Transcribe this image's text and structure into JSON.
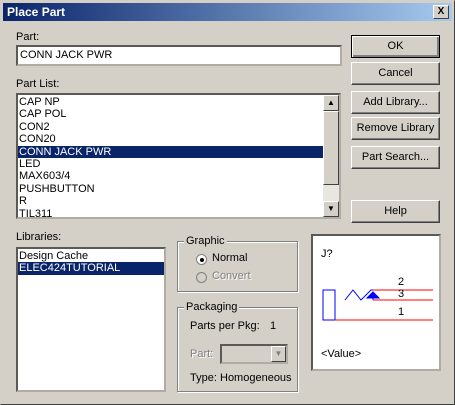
{
  "window": {
    "title": "Place Part",
    "close_glyph": "X"
  },
  "part": {
    "label": "Part:",
    "value": "CONN JACK PWR"
  },
  "part_list": {
    "label": "Part List:",
    "items": [
      "CAP NP",
      "CAP POL",
      "CON2",
      "CON20",
      "CONN JACK PWR",
      "LED",
      "MAX603/4",
      "PUSHBUTTON",
      "R",
      "TIL311"
    ],
    "selected": "CONN JACK PWR"
  },
  "libraries": {
    "label": "Libraries:",
    "items": [
      "Design Cache",
      "ELEC424TUTORIAL"
    ],
    "selected": "ELEC424TUTORIAL"
  },
  "graphic": {
    "label": "Graphic",
    "normal": "Normal",
    "convert": "Convert",
    "selected": "Normal"
  },
  "packaging": {
    "label": "Packaging",
    "parts_per_pkg_label": "Parts per Pkg:",
    "parts_per_pkg": "1",
    "part_label": "Part:",
    "type_label": "Type:",
    "type_value": "Homogeneous"
  },
  "buttons": {
    "ok": "OK",
    "cancel": "Cancel",
    "add_library": "Add Library...",
    "remove_library": "Remove Library",
    "part_search": "Part Search...",
    "help": "Help"
  },
  "preview": {
    "ref": "J?",
    "pins": [
      "2",
      "3",
      "1"
    ],
    "value": "<Value>",
    "pin_color": "#ff0000",
    "body_color": "#0000ff"
  }
}
